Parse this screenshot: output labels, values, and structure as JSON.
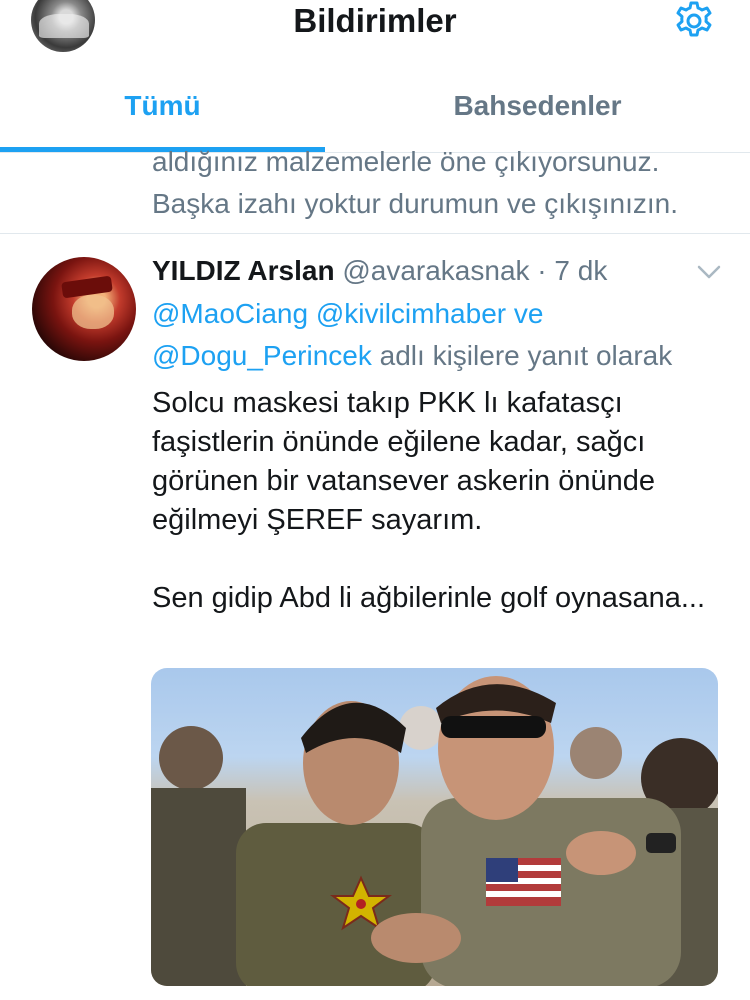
{
  "header": {
    "title": "Bildirimler",
    "avatar": "profile-avatar",
    "settings_icon": "gear-icon"
  },
  "tabs": [
    {
      "label": "Tümü",
      "active": true
    },
    {
      "label": "Bahsedenler",
      "active": false
    }
  ],
  "previous_tweet": {
    "lines": [
      "aldığınız malzemelerle öne çıkıyorsunuz.",
      "Başka izahı yoktur durumun ve çıkışınızın."
    ]
  },
  "tweet": {
    "name": "YILDIZ Arslan",
    "handle": "@avarakasnak",
    "separator": " · ",
    "time": "7 dk",
    "reply_to": {
      "mention1": "@MaoCiang",
      "mention2": "@kivilcimhaber",
      "and": "ve",
      "mention3": "@Dogu_Perincek",
      "suffix": "adlı kişilere yanıt olarak"
    },
    "text_para1": "Solcu maskesi takıp PKK lı kafatasçı faşistlerin önünde eğilene kadar, sağcı görünen bir vatansever askerin önünde eğilmeyi ŞEREF sayarım.",
    "text_para2": "Sen gidip Abd li ağbilerinle golf oynasana...",
    "media": "photo-soldiers"
  },
  "colors": {
    "accent": "#1da1f2",
    "secondary_text": "#657786",
    "primary_text": "#14171a",
    "divider": "#e1e8ed"
  }
}
